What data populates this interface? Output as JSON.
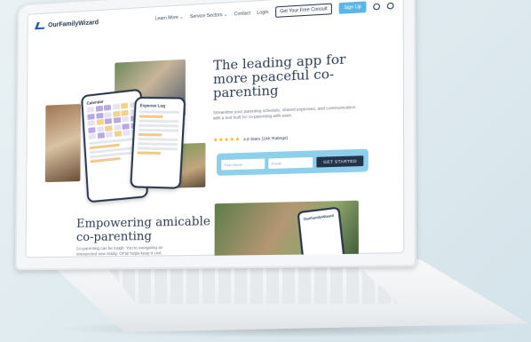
{
  "nav": {
    "logo": "OurFamilyWizard",
    "links": [
      "Learn More ⌄",
      "Service Sectors ⌄",
      "Contact",
      "Login"
    ],
    "cta_outline": "Get Your Free Consult",
    "cta_primary": "Sign Up"
  },
  "hero": {
    "title": "The leading app for more peaceful co-parenting",
    "subtitle": "Streamline your parenting schedule, shared expenses, and communication with a tool built for co-parenting with ease.",
    "rating_text": "4.8 Stars (24K Ratings)",
    "stars": "★★★★★",
    "form": {
      "first_name_placeholder": "First Name",
      "email_placeholder": "Email",
      "button": "GET STARTED"
    }
  },
  "section": {
    "title": "Empowering amicable co-parenting",
    "subtitle": "Co-parenting can be tough. You're navigating an unexpected new reality. OFW helps keep it civil."
  },
  "phones": {
    "calendar_title": "Calendar",
    "expense_title": "Expense Log",
    "card_title": "OurFamilyWizard"
  },
  "colors": {
    "accent": "#5ab6e6",
    "navy": "#24324a",
    "form_bg": "#8ecfeb"
  }
}
